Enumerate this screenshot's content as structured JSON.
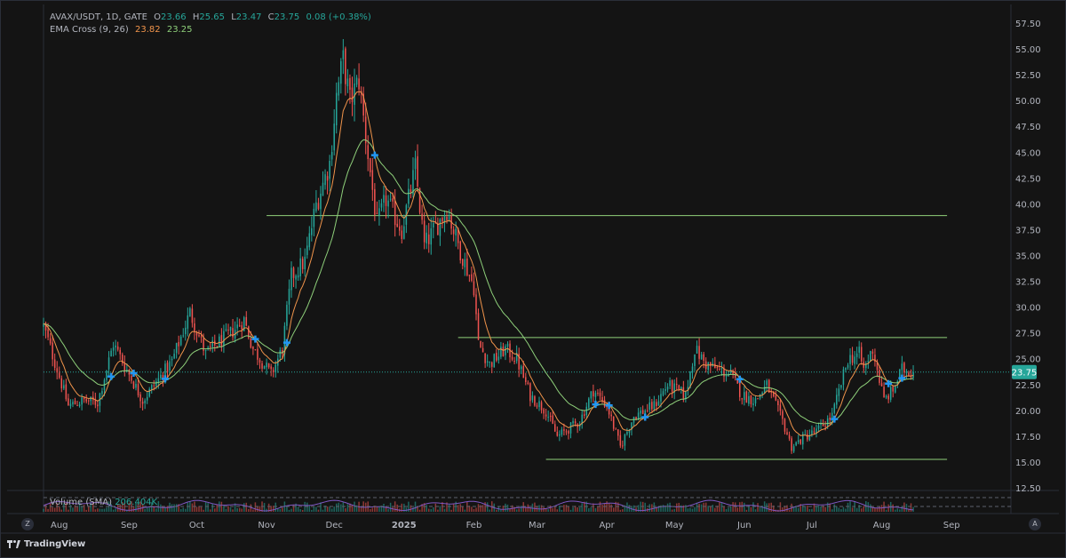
{
  "legend": {
    "symbol": "AVAX/USDT, 1D, GATE",
    "open_label": "O",
    "open": "23.66",
    "high_label": "H",
    "high": "25.65",
    "low_label": "L",
    "low": "23.47",
    "close_label": "C",
    "close": "23.75",
    "change": "0.08 (+0.38%)",
    "indicator": "EMA Cross (9, 26)",
    "ema_fast": "23.82",
    "ema_slow": "23.25"
  },
  "volume_legend": {
    "label": "Volume (SMA)",
    "value": "206.404K"
  },
  "price_tag": "23.75",
  "controls": {
    "z_label": "Z",
    "a_label": "A"
  },
  "footer": {
    "brand": "TradingView"
  },
  "colors": {
    "background": "#141414",
    "up": "#26a69a",
    "down": "#ef5350",
    "ema_fast": "#f0944b",
    "ema_slow": "#8ecf7a",
    "level_line": "#8fd07a",
    "cross_marker": "#2196f3",
    "volume_line": "#7e57c2",
    "price_tag_bg": "#26a69a"
  },
  "chart_data": {
    "type": "candlestick",
    "x_tick_labels": [
      "Aug",
      "Sep",
      "Oct",
      "Nov",
      "Dec",
      "2025",
      "Feb",
      "Mar",
      "Apr",
      "May",
      "Jun",
      "Jul",
      "Aug",
      "Sep"
    ],
    "y_tick_labels": [
      "57.50",
      "55.00",
      "52.50",
      "50.00",
      "47.50",
      "45.00",
      "42.50",
      "40.00",
      "37.50",
      "35.00",
      "32.50",
      "30.00",
      "27.50",
      "25.00",
      "22.50",
      "20.00",
      "17.50",
      "15.00",
      "12.50"
    ],
    "ylim": [
      12.5,
      57.5
    ],
    "x_range": [
      "2024-07-25",
      "2025-09-10"
    ],
    "price_keypoints": [
      [
        "2024-07-25",
        28.2
      ],
      [
        "2024-08-05",
        20.5
      ],
      [
        "2024-08-12",
        21.0
      ],
      [
        "2024-08-18",
        20.8
      ],
      [
        "2024-08-25",
        26.5
      ],
      [
        "2024-09-07",
        21.0
      ],
      [
        "2024-09-20",
        24.8
      ],
      [
        "2024-09-28",
        29.5
      ],
      [
        "2024-10-05",
        25.5
      ],
      [
        "2024-10-10",
        26.5
      ],
      [
        "2024-10-16",
        27.5
      ],
      [
        "2024-10-22",
        28.8
      ],
      [
        "2024-10-26",
        26.0
      ],
      [
        "2024-11-03",
        23.5
      ],
      [
        "2024-11-08",
        26.0
      ],
      [
        "2024-11-12",
        33.0
      ],
      [
        "2024-11-18",
        34.5
      ],
      [
        "2024-11-23",
        40.0
      ],
      [
        "2024-11-29",
        44.0
      ],
      [
        "2024-12-02",
        50.5
      ],
      [
        "2024-12-05",
        54.0
      ],
      [
        "2024-12-08",
        50.0
      ],
      [
        "2024-12-12",
        52.0
      ],
      [
        "2024-12-15",
        46.5
      ],
      [
        "2024-12-20",
        38.0
      ],
      [
        "2024-12-24",
        40.5
      ],
      [
        "2024-12-31",
        37.5
      ],
      [
        "2025-01-06",
        43.5
      ],
      [
        "2025-01-10",
        36.0
      ],
      [
        "2025-01-20",
        39.5
      ],
      [
        "2025-01-26",
        35.5
      ],
      [
        "2025-02-01",
        32.0
      ],
      [
        "2025-02-03",
        26.5
      ],
      [
        "2025-02-08",
        24.5
      ],
      [
        "2025-02-15",
        26.0
      ],
      [
        "2025-02-20",
        25.0
      ],
      [
        "2025-02-26",
        21.5
      ],
      [
        "2025-03-05",
        20.0
      ],
      [
        "2025-03-10",
        17.5
      ],
      [
        "2025-03-20",
        19.0
      ],
      [
        "2025-03-26",
        22.0
      ],
      [
        "2025-04-01",
        20.5
      ],
      [
        "2025-04-07",
        16.5
      ],
      [
        "2025-04-13",
        19.5
      ],
      [
        "2025-04-22",
        20.5
      ],
      [
        "2025-04-28",
        22.5
      ],
      [
        "2025-05-06",
        21.5
      ],
      [
        "2025-05-10",
        26.0
      ],
      [
        "2025-05-15",
        24.5
      ],
      [
        "2025-05-20",
        24.0
      ],
      [
        "2025-05-26",
        23.5
      ],
      [
        "2025-05-31",
        21.5
      ],
      [
        "2025-06-06",
        21.0
      ],
      [
        "2025-06-11",
        22.5
      ],
      [
        "2025-06-18",
        19.0
      ],
      [
        "2025-06-22",
        16.5
      ],
      [
        "2025-06-28",
        17.5
      ],
      [
        "2025-07-03",
        18.0
      ],
      [
        "2025-07-10",
        19.5
      ],
      [
        "2025-07-17",
        25.0
      ],
      [
        "2025-07-22",
        25.5
      ],
      [
        "2025-07-24",
        24.0
      ],
      [
        "2025-07-28",
        26.0
      ],
      [
        "2025-08-02",
        21.0
      ],
      [
        "2025-08-06",
        22.0
      ],
      [
        "2025-08-10",
        24.0
      ],
      [
        "2025-08-15",
        23.75
      ]
    ],
    "horizontal_levels": [
      {
        "from": "2024-11-01",
        "to": "2025-08-30",
        "value": 38.9
      },
      {
        "from": "2025-01-25",
        "to": "2025-08-30",
        "value": 27.1
      },
      {
        "from": "2025-03-05",
        "to": "2025-08-30",
        "value": 15.3
      }
    ],
    "last_price": 23.75,
    "series": [
      {
        "name": "EMA 9",
        "style": "line"
      },
      {
        "name": "EMA 26",
        "style": "line"
      }
    ]
  }
}
